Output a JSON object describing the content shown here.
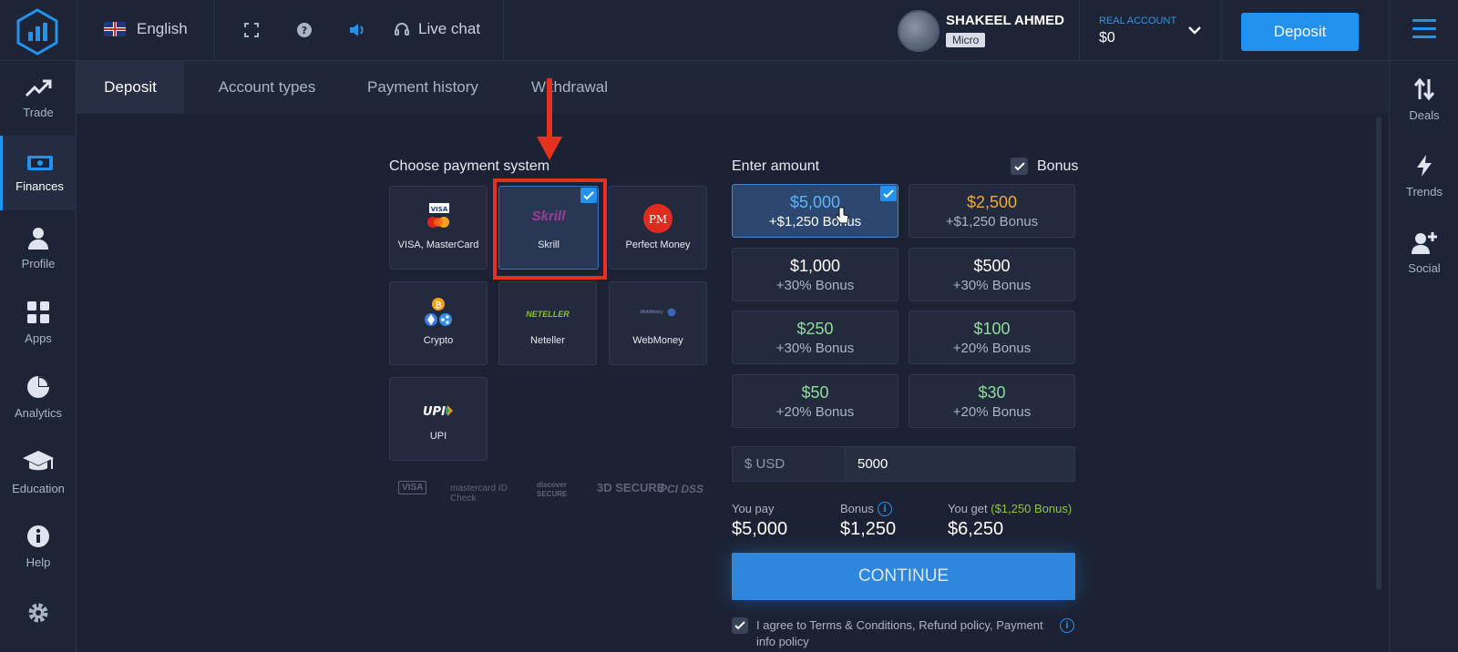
{
  "header": {
    "language": "English",
    "live_chat": "Live chat",
    "user_name": "SHAKEEL AHMED",
    "account_tier": "Micro",
    "account_type": "REAL ACCOUNT",
    "balance": "$0",
    "deposit_button": "Deposit"
  },
  "sidebar": {
    "items": [
      {
        "label": "Trade",
        "icon": "trend-up-icon"
      },
      {
        "label": "Finances",
        "icon": "banknote-icon"
      },
      {
        "label": "Profile",
        "icon": "user-icon"
      },
      {
        "label": "Apps",
        "icon": "grid-icon"
      },
      {
        "label": "Analytics",
        "icon": "pie-chart-icon"
      },
      {
        "label": "Education",
        "icon": "graduation-cap-icon"
      },
      {
        "label": "Help",
        "icon": "info-icon"
      }
    ]
  },
  "right_sidebar": {
    "items": [
      {
        "label": "Deals",
        "icon": "swap-vertical-icon"
      },
      {
        "label": "Trends",
        "icon": "lightning-icon"
      },
      {
        "label": "Social",
        "icon": "add-user-icon"
      }
    ]
  },
  "tabs": [
    "Deposit",
    "Account types",
    "Payment history",
    "Withdrawal"
  ],
  "payment": {
    "title": "Choose payment system",
    "methods": [
      {
        "label": "VISA, MasterCard",
        "logo": "VISA"
      },
      {
        "label": "Skrill",
        "logo": "Skrill"
      },
      {
        "label": "Perfect Money",
        "logo": "PM"
      },
      {
        "label": "Crypto",
        "logo": "crypto-coins"
      },
      {
        "label": "Neteller",
        "logo": "NETELLER"
      },
      {
        "label": "WebMoney",
        "logo": "WebMoney"
      },
      {
        "label": "UPI",
        "logo": "UPI"
      }
    ],
    "security_logos": [
      "VISA",
      "mastercard ID Check",
      "discover SECURE",
      "3D SECURE",
      "PCI DSS"
    ]
  },
  "amount": {
    "title": "Enter amount",
    "bonus_label": "Bonus",
    "options": [
      {
        "value": "$5,000",
        "bonus": "+$1,250 Bonus",
        "color": "#5fb4f5"
      },
      {
        "value": "$2,500",
        "bonus": "+$1,250 Bonus",
        "color": "#f2a93b"
      },
      {
        "value": "$1,000",
        "bonus": "+30% Bonus",
        "color": "#ffffff"
      },
      {
        "value": "$500",
        "bonus": "+30% Bonus",
        "color": "#ffffff"
      },
      {
        "value": "$250",
        "bonus": "+30% Bonus",
        "color": "#8fdc9c"
      },
      {
        "value": "$100",
        "bonus": "+20% Bonus",
        "color": "#8fdc9c"
      },
      {
        "value": "$50",
        "bonus": "+20% Bonus",
        "color": "#8fdc9c"
      },
      {
        "value": "$30",
        "bonus": "+20% Bonus",
        "color": "#8fdc9c"
      }
    ],
    "currency": "$ USD",
    "input_value": "5000"
  },
  "summary": {
    "you_pay_label": "You pay",
    "you_pay": "$5,000",
    "bonus_label": "Bonus",
    "bonus": "$1,250",
    "you_get_label": "You get",
    "you_get_bonus": "($1,250 Bonus)",
    "you_get": "$6,250"
  },
  "continue_button": "CONTINUE",
  "agree_text": "I agree to Terms & Conditions, Refund policy, Payment info policy"
}
